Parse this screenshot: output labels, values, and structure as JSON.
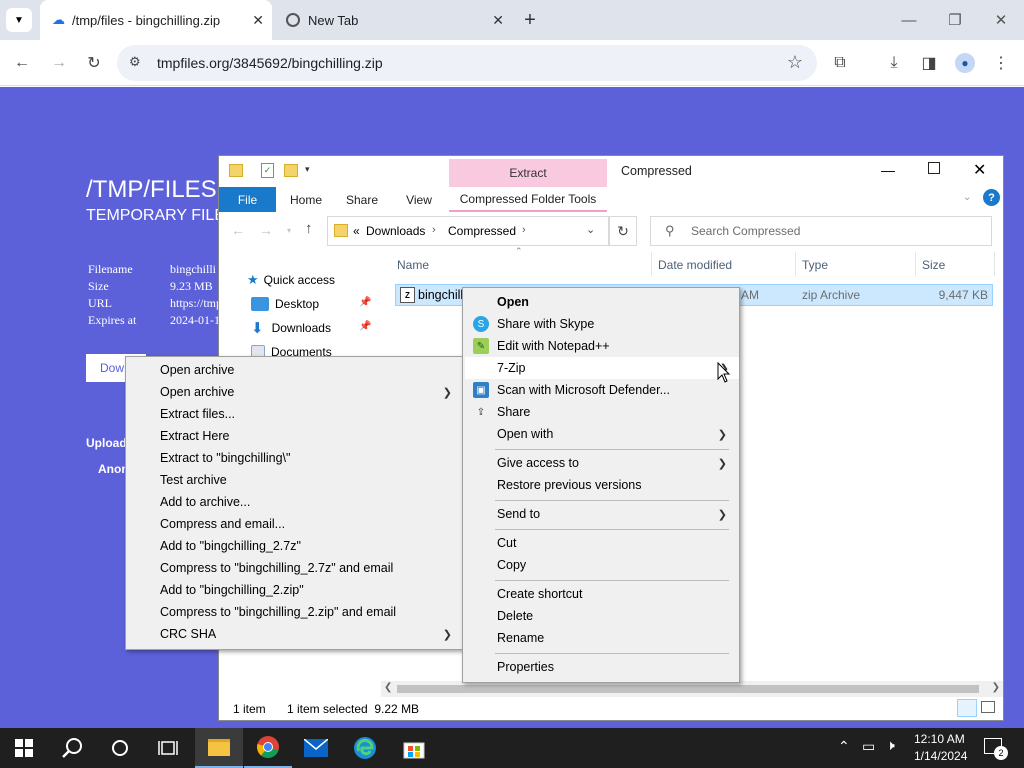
{
  "browser": {
    "tabs": [
      {
        "title": "/tmp/files - bingchilling.zip",
        "active": true
      },
      {
        "title": "New Tab",
        "active": false
      }
    ],
    "url": "tmpfiles.org/3845692/bingchilling.zip"
  },
  "page": {
    "title": "/TMP/FILES",
    "subtitle": "TEMPORARY FILE",
    "fields": [
      {
        "label": "Filename",
        "value": "bingchilli"
      },
      {
        "label": "Size",
        "value": "9.23 MB"
      },
      {
        "label": "URL",
        "value": "https://tmp"
      },
      {
        "label": "Expires at",
        "value": "2024-01-1"
      }
    ],
    "download_label": "Dow",
    "upload_label": "Upload",
    "anon_label": "Anon"
  },
  "explorer": {
    "quick_tabs": {
      "extract": "Extract",
      "window_title": "Compressed"
    },
    "ribbon_tabs": [
      "File",
      "Home",
      "Share",
      "View",
      "Compressed Folder Tools"
    ],
    "breadcrumb": [
      "«",
      "Downloads",
      "Compressed"
    ],
    "search_placeholder": "Search Compressed",
    "columns": [
      "Name",
      "Date modified",
      "Type",
      "Size"
    ],
    "nav": [
      "Quick access",
      "Desktop",
      "Downloads",
      "Documents"
    ],
    "file": {
      "name": "bingchill",
      "date": "AM",
      "type": "zip Archive",
      "size": "9,447 KB"
    },
    "status": {
      "count": "1 item",
      "selected": "1 item selected  9.22 MB"
    }
  },
  "context_menu": {
    "items": [
      {
        "label": "Open",
        "bold": true
      },
      {
        "label": "Share with Skype",
        "icon": "skype-icon"
      },
      {
        "label": "Edit with Notepad++",
        "icon": "notepadpp-icon"
      },
      {
        "label": "7-Zip",
        "submenu": true
      },
      {
        "label": "Scan with Microsoft Defender...",
        "icon": "defender-icon"
      },
      {
        "label": "Share",
        "icon": "share-icon"
      },
      {
        "label": "Open with",
        "submenu": true
      },
      {
        "label": "Give access to",
        "submenu": true
      },
      {
        "label": "Restore previous versions"
      },
      {
        "label": "Send to",
        "submenu": true
      },
      {
        "label": "Cut"
      },
      {
        "label": "Copy"
      },
      {
        "label": "Create shortcut"
      },
      {
        "label": "Delete"
      },
      {
        "label": "Rename"
      },
      {
        "label": "Properties"
      }
    ]
  },
  "zip_menu": {
    "items": [
      {
        "label": "Open archive"
      },
      {
        "label": "Open archive",
        "submenu": true
      },
      {
        "label": "Extract files..."
      },
      {
        "label": "Extract Here"
      },
      {
        "label": "Extract to \"bingchilling\\\""
      },
      {
        "label": "Test archive"
      },
      {
        "label": "Add to archive..."
      },
      {
        "label": "Compress and email..."
      },
      {
        "label": "Add to \"bingchilling_2.7z\""
      },
      {
        "label": "Compress to \"bingchilling_2.7z\" and email"
      },
      {
        "label": "Add to \"bingchilling_2.zip\""
      },
      {
        "label": "Compress to \"bingchilling_2.zip\" and email"
      },
      {
        "label": "CRC SHA",
        "submenu": true
      }
    ]
  },
  "taskbar": {
    "time": "12:10 AM",
    "date": "1/14/2024",
    "notification_count": "2"
  },
  "colors": {
    "page_bg": "#5c61da",
    "ribbon_file": "#1979ca",
    "compressed_tools": "#f9c9e0",
    "selection": "#cce8ff"
  }
}
